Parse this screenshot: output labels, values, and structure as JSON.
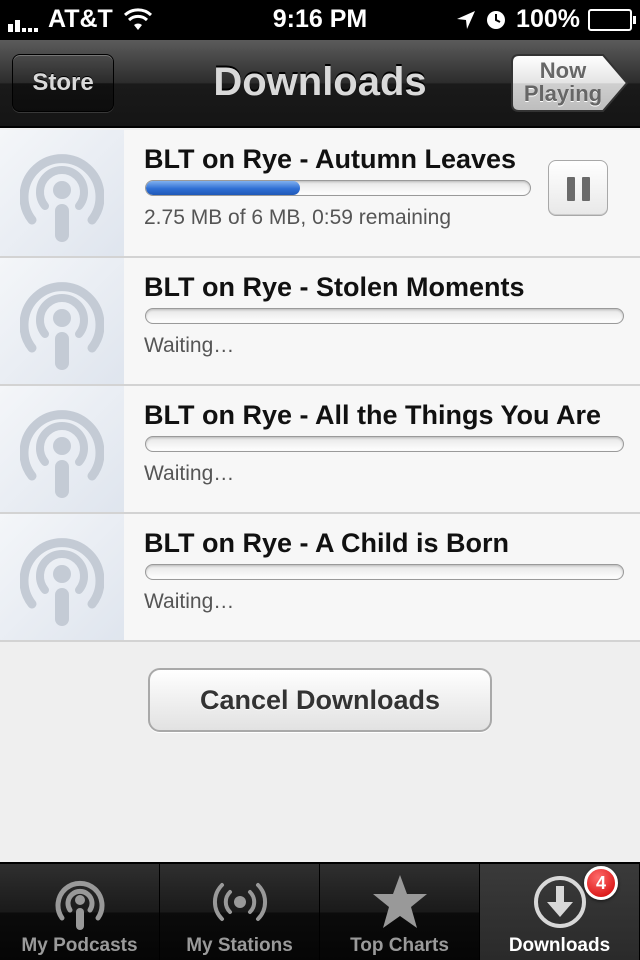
{
  "status_bar": {
    "carrier": "AT&T",
    "time": "9:16 PM",
    "battery": "100%",
    "icons": [
      "signal-icon",
      "wifi-icon",
      "location-icon",
      "alarm-icon",
      "battery-icon"
    ]
  },
  "nav": {
    "title": "Downloads",
    "store_label": "Store",
    "now_playing_label": "Now Playing"
  },
  "downloads": [
    {
      "title": "BLT on Rye - Autumn Leaves",
      "status": "2.75 MB of 6 MB, 0:59 remaining",
      "progress": 0.4,
      "active": true
    },
    {
      "title": "BLT on Rye - Stolen Moments",
      "status": "Waiting…",
      "progress": 0,
      "active": false
    },
    {
      "title": "BLT on Rye - All the Things You Are",
      "status": "Waiting…",
      "progress": 0,
      "active": false
    },
    {
      "title": "BLT on Rye - A Child is Born",
      "status": "Waiting…",
      "progress": 0,
      "active": false
    }
  ],
  "cancel_label": "Cancel Downloads",
  "tabs": [
    {
      "label": "My Podcasts",
      "icon": "podcast-icon"
    },
    {
      "label": "My Stations",
      "icon": "stations-icon"
    },
    {
      "label": "Top Charts",
      "icon": "star-icon"
    },
    {
      "label": "Downloads",
      "icon": "download-icon",
      "active": true
    }
  ],
  "downloads_badge": "4",
  "colors": {
    "accent": "#2f6fd4",
    "badge": "#d00000"
  }
}
